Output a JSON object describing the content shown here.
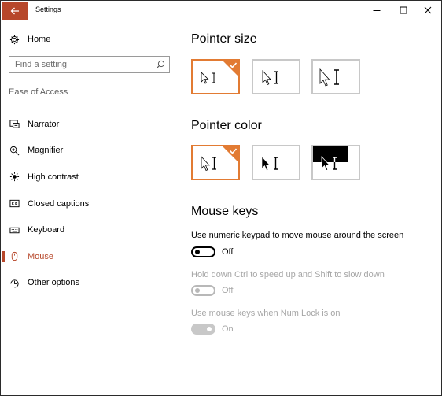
{
  "window": {
    "title": "Settings",
    "accent_color": "#b7472a",
    "selection_color": "#e27b33"
  },
  "titlebar": {
    "back_icon": "back-arrow-icon",
    "minimize_icon": "minimize-icon",
    "maximize_icon": "maximize-icon",
    "close_icon": "close-icon"
  },
  "sidebar": {
    "home": {
      "label": "Home",
      "icon": "gear-icon"
    },
    "search": {
      "placeholder": "Find a setting",
      "icon": "search-icon"
    },
    "section_label": "Ease of Access",
    "items": [
      {
        "label": "Narrator",
        "icon": "narrator-icon",
        "active": false
      },
      {
        "label": "Magnifier",
        "icon": "magnifier-icon",
        "active": false
      },
      {
        "label": "High contrast",
        "icon": "high-contrast-icon",
        "active": false
      },
      {
        "label": "Closed captions",
        "icon": "closed-captions-icon",
        "active": false
      },
      {
        "label": "Keyboard",
        "icon": "keyboard-icon",
        "active": false
      },
      {
        "label": "Mouse",
        "icon": "mouse-icon",
        "active": true
      },
      {
        "label": "Other options",
        "icon": "other-options-icon",
        "active": false
      }
    ]
  },
  "main": {
    "pointer_size": {
      "heading": "Pointer size",
      "selected_index": 0
    },
    "pointer_color": {
      "heading": "Pointer color",
      "selected_index": 0
    },
    "mouse_keys": {
      "heading": "Mouse keys",
      "settings": [
        {
          "label": "Use numeric keypad to move mouse around the screen",
          "state": "Off",
          "enabled": true
        },
        {
          "label": "Hold down Ctrl to speed up and Shift to slow down",
          "state": "Off",
          "enabled": false
        },
        {
          "label": "Use mouse keys when Num Lock is on",
          "state": "On",
          "enabled": false
        }
      ]
    }
  }
}
